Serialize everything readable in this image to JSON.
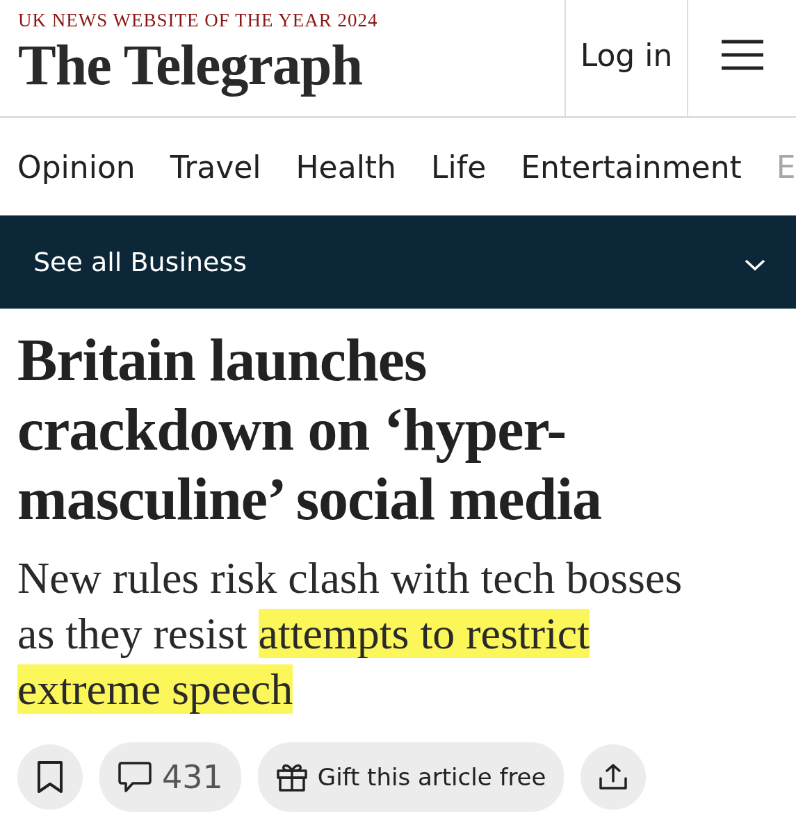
{
  "header": {
    "award": "UK NEWS WEBSITE OF THE YEAR 2024",
    "logo": "The Telegraph",
    "login": "Log in"
  },
  "nav": [
    {
      "label": "Opinion",
      "faded": false
    },
    {
      "label": "Travel",
      "faded": false
    },
    {
      "label": "Health",
      "faded": false
    },
    {
      "label": "Life",
      "faded": false
    },
    {
      "label": "Entertainment",
      "faded": false
    },
    {
      "label": "E",
      "faded": true
    }
  ],
  "section_bar": {
    "label": "See all Business"
  },
  "article": {
    "headline": "Britain launches crackdown on ‘hyper-masculine’ social media",
    "standfirst": [
      {
        "text": "New rules risk clash with tech bosses as they resist ",
        "highlighted": false
      },
      {
        "text": "attempts to restrict extreme speech",
        "highlighted": true
      }
    ]
  },
  "actions": [
    {
      "kind": "bookmark"
    },
    {
      "kind": "comments",
      "label": "431"
    },
    {
      "kind": "gift",
      "label": "Gift this article free"
    },
    {
      "kind": "share"
    }
  ]
}
